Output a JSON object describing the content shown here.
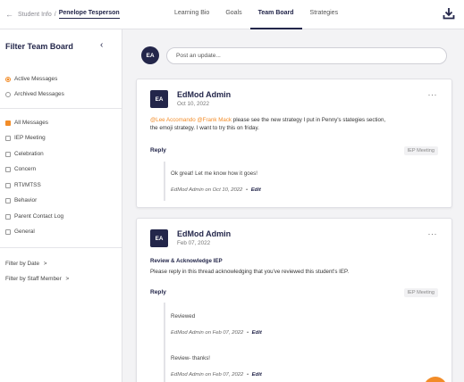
{
  "breadcrumb": {
    "parent": "Student Info",
    "separator": "/",
    "current": "Penelope Tesperson"
  },
  "tabs": [
    "Learning Bio",
    "Goals",
    "Team Board",
    "Strategies"
  ],
  "active_tab": "Team Board",
  "sidebar": {
    "title": "Filter Team Board",
    "message_state": [
      {
        "label": "Active Messages",
        "selected": true
      },
      {
        "label": "Archived Messages",
        "selected": false
      }
    ],
    "categories": [
      {
        "label": "All Messages",
        "checked": true
      },
      {
        "label": "IEP Meeting",
        "checked": false
      },
      {
        "label": "Celebration",
        "checked": false
      },
      {
        "label": "Concern",
        "checked": false
      },
      {
        "label": "RTI/MTSS",
        "checked": false
      },
      {
        "label": "Behavior",
        "checked": false
      },
      {
        "label": "Parent Contact Log",
        "checked": false
      },
      {
        "label": "General",
        "checked": false
      }
    ],
    "filter_by_date": "Filter by Date",
    "filter_by_staff": "Filter by Staff Member",
    "chevron": ">"
  },
  "composer": {
    "avatar_initials": "EA",
    "placeholder": "Post an update..."
  },
  "posts": [
    {
      "avatar_initials": "EA",
      "author": "EdMod Admin",
      "date": "Oct 10, 2022",
      "mention1": "@Lee Accomando",
      "mention2": "@Frank Mack",
      "body_line1": "please see the new strategy I put in Penny's stategies section,",
      "body_line2": "the emoji strategy. I want to try this on friday.",
      "reply_label": "Reply",
      "tag": "IEP Meeting",
      "replies": [
        {
          "text": "Ok great! Let me know how it goes!",
          "meta": "EdMod Admin on Oct 10, 2022",
          "bullet": "•",
          "edit": "Edit"
        }
      ]
    },
    {
      "avatar_initials": "EA",
      "author": "EdMod Admin",
      "date": "Feb 07, 2022",
      "subject": "Review & Acknowledge IEP",
      "body": "Please reply in this thread acknowledging that you've reviewed this student's IEP.",
      "reply_label": "Reply",
      "tag": "IEP Meeting",
      "replies": [
        {
          "text": "Reviewed",
          "meta": "EdMod Admin on Feb 07, 2022",
          "bullet": "•",
          "edit": "Edit"
        },
        {
          "text": "Review- thanks!",
          "meta": "EdMod Admin on Feb 07, 2022",
          "bullet": "•",
          "edit": "Edit"
        }
      ]
    }
  ],
  "icons": {
    "back": "arrow-left-icon",
    "collapse": "chevron-left-icon",
    "download": "download-icon",
    "more": "more-horizontal-icon"
  },
  "colors": {
    "accent": "#f28c28",
    "navy": "#23264a"
  },
  "more_glyph": "···"
}
